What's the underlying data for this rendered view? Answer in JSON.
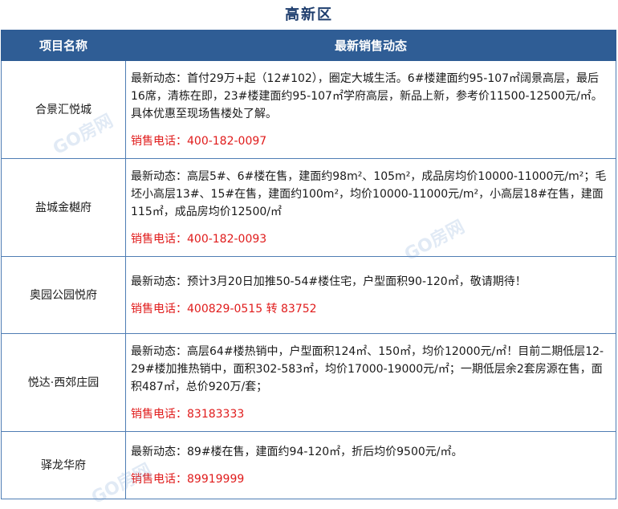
{
  "title": "高新区",
  "header": {
    "col_name": "项目名称",
    "col_news": "最新销售动态"
  },
  "rows": [
    {
      "name": "合景汇悦城",
      "news": "最新动态：首付29万+起（12#102），圈定大城生活。6#楼建面约95-107㎡阔景高层，最后16席，清栋在即，23#楼建面约95-107㎡学府高层，新品上新，参考价11500-12500元/㎡。具体优惠至现场售楼处了解。",
      "phone": "销售电话：400-182-0097"
    },
    {
      "name": "盐城金樾府",
      "news": "最新动态：高层5#、6#楼在售，建面约98m²、105m²，成品房均价10000-11000元/m²；毛坯小高层13#、15#在售，建面约100m²，均价10000-11000元/m²，小高层18#在售，建面115㎡，成品房均价12500/㎡",
      "phone": "销售电话：400-182-0093"
    },
    {
      "name": "奥园公园悦府",
      "news": "最新动态：预计3月20日加推50-54#楼住宅，户型面积90-120㎡，敬请期待！",
      "phone": "销售电话：400829-0515 转 83752"
    },
    {
      "name": "悦达·西郊庄园",
      "news": "最新动态：高层64#楼热销中，户型面积124㎡、150㎡，均价12000元/㎡！目前二期低层12-29#楼加推热销中，面积302-583㎡，均价17000-19000元/㎡；一期低层余2套房源在售，面积487㎡，总价920万/套；",
      "phone": "销售电话：83183333"
    },
    {
      "name": "驿龙华府",
      "news": "最新动态：89#楼在售，建面约94-120㎡，折后均价9500元/㎡。",
      "phone": "销售电话：89919999"
    }
  ],
  "watermark": "GO房网"
}
